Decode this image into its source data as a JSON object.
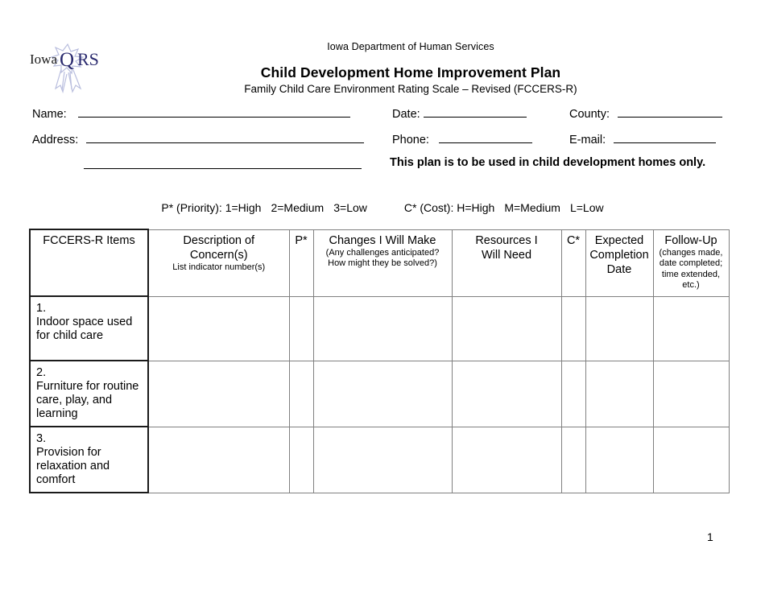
{
  "logo": {
    "text_iowa": "Iowa",
    "text_qrs": "QRS",
    "alt": "Iowa QRS ribbon logo",
    "ribbon_color": "#b9bede",
    "qrs_color": "#2a2a6e"
  },
  "header": {
    "department": "Iowa Department of Human Services",
    "title": "Child Development Home Improvement Plan",
    "subtitle": "Family Child Care Environment Rating Scale – Revised (FCCERS-R)"
  },
  "form": {
    "name_label": "Name:",
    "name_value": "",
    "address_label": "Address:",
    "address_value": "",
    "address_value2": "",
    "date_label": "Date:",
    "date_value": "",
    "county_label": "County:",
    "county_value": "",
    "phone_label": "Phone:",
    "phone_value": "",
    "email_label": "E-mail:",
    "email_value": "",
    "notice": "This plan is to be used in child development homes only."
  },
  "key": {
    "priority": "P* (Priority): 1=High",
    "priority_2": "2=Medium",
    "priority_3": "3=Low",
    "cost": "C* (Cost): H=High",
    "cost_2": "M=Medium",
    "cost_3": "L=Low"
  },
  "table": {
    "headers": {
      "items": "FCCERS-R Items",
      "concern_l1": "Description of",
      "concern_l2": "Concern(s)",
      "concern_sub": "List indicator number(s)",
      "p": "P*",
      "changes_l1": "Changes I Will Make",
      "changes_sub1": "(Any challenges anticipated?",
      "changes_sub2": "How might they be solved?)",
      "resources_l1": "Resources I",
      "resources_l2": "Will Need",
      "c": "C*",
      "expected_l1": "Expected",
      "expected_l2": "Completion",
      "expected_l3": "Date",
      "followup_l1": "Follow-Up",
      "followup_sub1": "(changes made,",
      "followup_sub2": "date completed;",
      "followup_sub3": "time extended,",
      "followup_sub4": "etc.)"
    },
    "rows": [
      {
        "number": "1.",
        "item_l1": "Indoor space used",
        "item_l2": "for child care",
        "concern": "",
        "p": "",
        "changes": "",
        "resources": "",
        "c": "",
        "expected": "",
        "followup": ""
      },
      {
        "number": "2.",
        "item_l1": "Furniture for routine",
        "item_l2": "care, play, and",
        "item_l3": "learning",
        "concern": "",
        "p": "",
        "changes": "",
        "resources": "",
        "c": "",
        "expected": "",
        "followup": ""
      },
      {
        "number": "3.",
        "item_l1": "Provision for",
        "item_l2": "relaxation and",
        "item_l3": "comfort",
        "concern": "",
        "p": "",
        "changes": "",
        "resources": "",
        "c": "",
        "expected": "",
        "followup": ""
      }
    ]
  },
  "footer": {
    "page_number": "1"
  }
}
